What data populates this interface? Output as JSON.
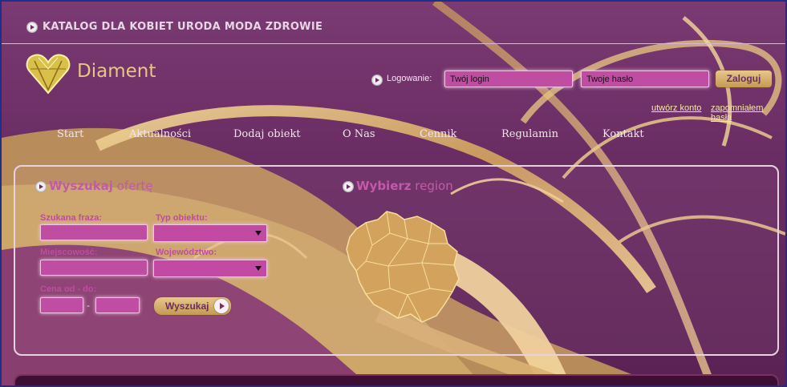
{
  "header": {
    "catalog_title": "KATALOG DLA KOBIET URODA MODA ZDROWIE",
    "logo_text": "Diament"
  },
  "login": {
    "label": "Logowanie:",
    "login_placeholder": "Twój login",
    "password_placeholder": "Twoje hasło",
    "submit_label": "Zaloguj",
    "create_account_link": "utwórz konto",
    "forgot_password_link": "zapomniałem hasła"
  },
  "nav": {
    "items": [
      {
        "label": "Start"
      },
      {
        "label": "Aktualności"
      },
      {
        "label": "Dodaj obiekt"
      },
      {
        "label": "O Nas"
      },
      {
        "label": "Cennik"
      },
      {
        "label": "Regulamin"
      },
      {
        "label": "Kontakt"
      }
    ]
  },
  "search": {
    "title_bold": "Wyszukaj",
    "title_rest": "ofertę",
    "phrase_label": "Szukana fraza:",
    "type_label": "Typ obiektu:",
    "city_label": "Miejscowość:",
    "voivodeship_label": "Województwo:",
    "price_label": "Cena od - do:",
    "price_separator": "-",
    "submit_label": "Wyszukaj"
  },
  "region": {
    "title_bold": "Wybierz",
    "title_rest": "region"
  },
  "colors": {
    "background": "#6a2d63",
    "accent_pink": "#bf4ea2",
    "gold": "#e8c78a",
    "label_pink": "#c24aa2"
  },
  "icons": {
    "bullet": "circle-arrow-right-icon",
    "dropdown": "chevron-down-icon"
  }
}
